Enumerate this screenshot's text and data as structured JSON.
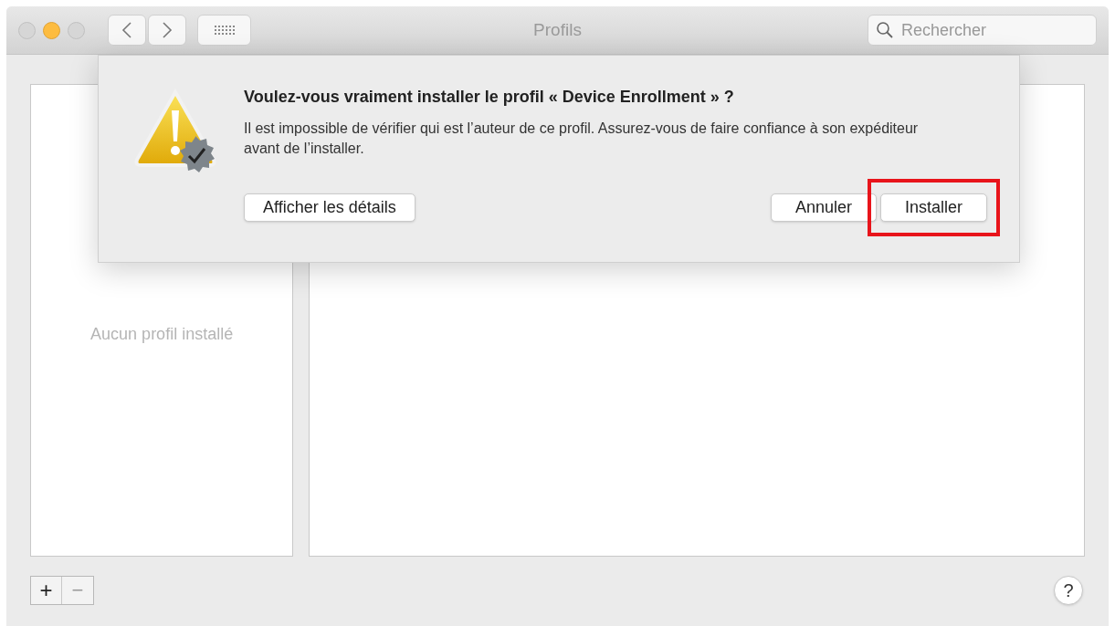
{
  "window": {
    "title": "Profils"
  },
  "search": {
    "placeholder": "Rechercher"
  },
  "sidebar": {
    "empty_text": "Aucun profil installé"
  },
  "footer": {
    "add": "+",
    "remove": "−",
    "remove_disabled": true,
    "help": "?"
  },
  "dialog": {
    "title": "Voulez-vous vraiment installer le profil « Device Enrollment » ?",
    "message": "Il est impossible de vérifier qui est l’auteur de ce profil. Assurez-vous de faire confiance à son expéditeur avant de l’installer.",
    "buttons": [
      {
        "label": "Afficher les détails",
        "kind": "left",
        "highlighted": false
      },
      {
        "label": "Annuler",
        "kind": "right",
        "highlighted": false
      },
      {
        "label": "Installer",
        "kind": "right",
        "highlighted": true
      }
    ]
  }
}
